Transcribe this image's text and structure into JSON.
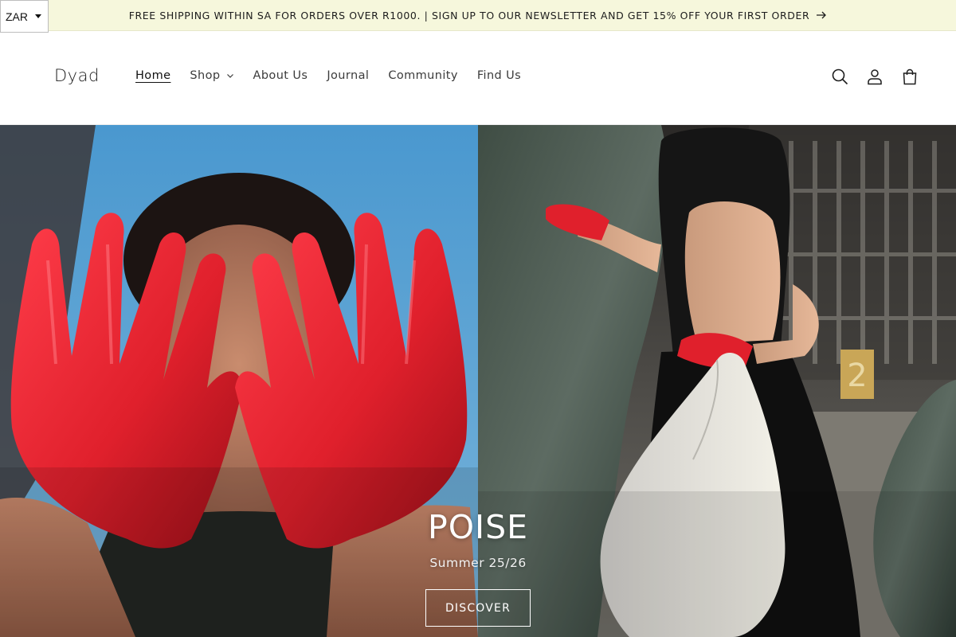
{
  "announcement": {
    "text": "FREE SHIPPING WITHIN SA FOR ORDERS OVER R1000. | SIGN UP TO OUR NEWSLETTER AND GET 15% OFF YOUR FIRST ORDER",
    "icon": "arrow-right-icon"
  },
  "currency": {
    "selected": "ZAR"
  },
  "header": {
    "logo": "Dyad",
    "nav": [
      {
        "label": "Home",
        "active": true
      },
      {
        "label": "Shop",
        "has_dropdown": true
      },
      {
        "label": "About Us"
      },
      {
        "label": "Journal"
      },
      {
        "label": "Community"
      },
      {
        "label": "Find Us"
      }
    ],
    "icons": [
      "search-icon",
      "account-icon",
      "cart-icon"
    ]
  },
  "hero": {
    "title": "POISE",
    "subtitle": "Summer 25/26",
    "button_label": "DISCOVER"
  },
  "colors": {
    "announcement_bg": "#f6f7dc",
    "glove_red": "#e0202c",
    "sky_blue": "#4a98cf"
  }
}
